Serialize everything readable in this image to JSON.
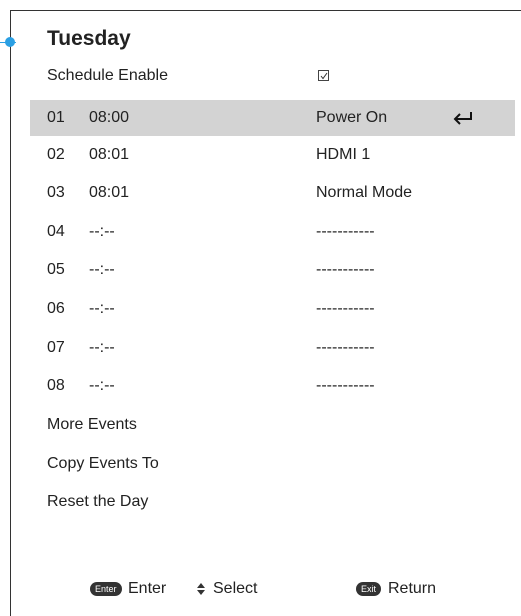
{
  "schedule": {
    "title": "Tuesday",
    "enable_label": "Schedule Enable",
    "enable_checked": true,
    "events": [
      {
        "num": "01",
        "time": "08:00",
        "action": "Power On",
        "selected": true
      },
      {
        "num": "02",
        "time": "08:01",
        "action": "HDMI 1",
        "selected": false
      },
      {
        "num": "03",
        "time": "08:01",
        "action": "Normal Mode",
        "selected": false
      },
      {
        "num": "04",
        "time": "--:--",
        "action": "-----------",
        "selected": false
      },
      {
        "num": "05",
        "time": "--:--",
        "action": "-----------",
        "selected": false
      },
      {
        "num": "06",
        "time": "--:--",
        "action": "-----------",
        "selected": false
      },
      {
        "num": "07",
        "time": "--:--",
        "action": "-----------",
        "selected": false
      },
      {
        "num": "08",
        "time": "--:--",
        "action": "-----------",
        "selected": false
      }
    ],
    "more_events": "More Events",
    "copy_events": "Copy Events To",
    "reset_day": "Reset the Day"
  },
  "footer": {
    "enter_key": "Enter",
    "enter_label": "Enter",
    "select_label": "Select",
    "exit_key": "Exit",
    "return_label": "Return"
  },
  "colors": {
    "highlight": "#d3d3d3",
    "accent": "#2b9fe3",
    "pill": "#333333"
  }
}
